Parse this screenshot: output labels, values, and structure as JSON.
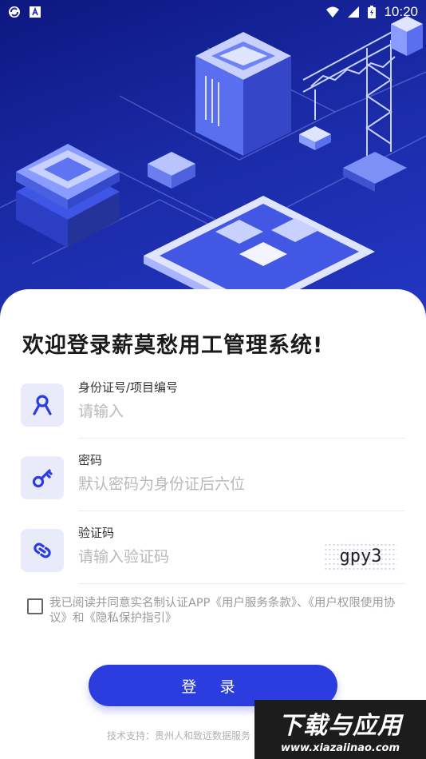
{
  "status_bar": {
    "time": "10:20",
    "left_icons": [
      "sync-icon",
      "keyboard-icon"
    ],
    "right_icons": [
      "wifi-icon",
      "signal-icon",
      "battery-icon"
    ]
  },
  "title": "欢迎登录薪莫愁用工管理系统!",
  "fields": [
    {
      "label": "身份证号/项目编号",
      "placeholder": "请输入",
      "icon": "person-icon"
    },
    {
      "label": "密码",
      "placeholder": "默认密码为身份证后六位",
      "icon": "key-icon"
    },
    {
      "label": "验证码",
      "placeholder": "请输入验证码",
      "icon": "link-icon",
      "captcha": "gpy3"
    }
  ],
  "agreement": {
    "text": "我已阅读并同意实名制认证APP《用户服务条款》、《用户权限使用协议》和《隐私保护指引》",
    "checked": false
  },
  "login_button": "登 录",
  "support": "技术支持：贵州人和致远数据服务",
  "watermark": {
    "main": "下载与应用",
    "url": "www.xiazaiinao.com"
  },
  "colors": {
    "primary": "#2c3de0",
    "hero": "#1a2aa6",
    "icon_bg": "#e9ebfb"
  }
}
